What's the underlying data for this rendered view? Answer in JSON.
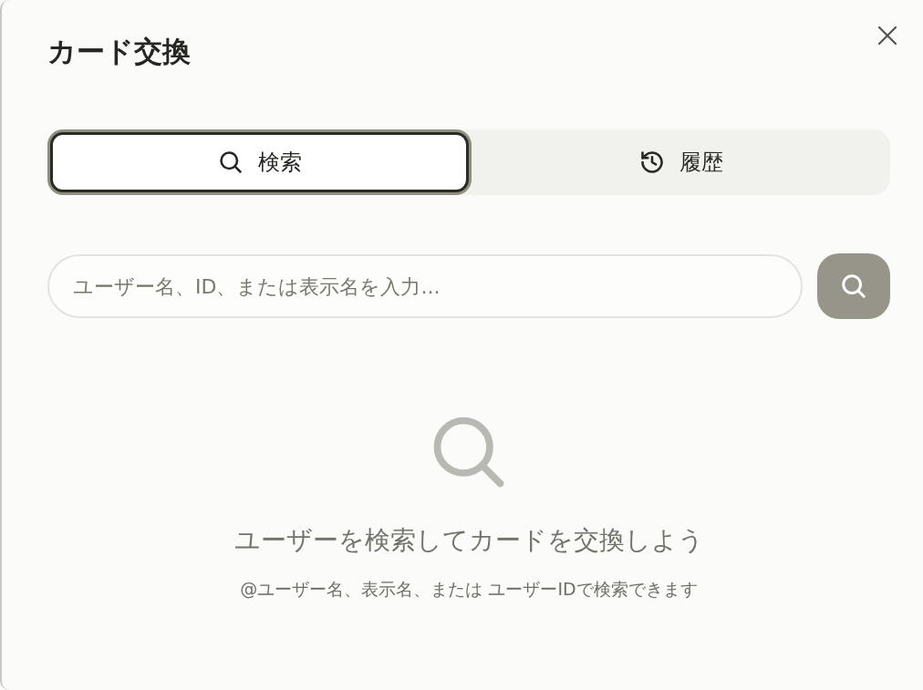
{
  "dialog": {
    "title": "カード交換"
  },
  "tabs": [
    {
      "label": "検索",
      "kind": "search",
      "selected": true
    },
    {
      "label": "履歴",
      "kind": "history",
      "selected": false
    }
  ],
  "search": {
    "placeholder": "ユーザー名、ID、または表示名を入力..."
  },
  "empty_state": {
    "heading": "ユーザーを検索してカードを交換しよう",
    "hint": "@ユーザー名、表示名、または ユーザーIDで検索できます"
  }
}
